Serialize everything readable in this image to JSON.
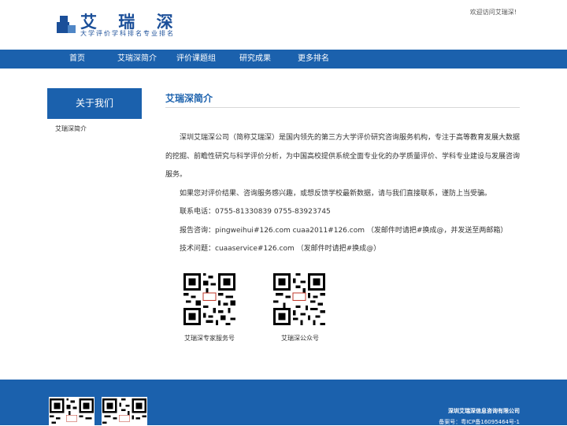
{
  "header": {
    "logo_title": "艾 瑞 深",
    "logo_subtitle": "大学评价学科排名专业排名",
    "welcome_text": "欢迎访问艾瑞深!"
  },
  "nav": {
    "items": [
      "首页",
      "艾瑞深简介",
      "评价课题组",
      "研究成果",
      "更多排名"
    ]
  },
  "sidebar": {
    "title": "关于我们",
    "items": [
      "艾瑞深简介"
    ]
  },
  "main": {
    "title": "艾瑞深简介",
    "paragraph_1": "深圳艾瑞深公司（简称艾瑞深）是国内领先的第三方大学评价研究咨询服务机构，专注于高等教育发展大数据的挖掘、前瞻性研究与科学评价分析，为中国高校提供系统全面专业化的办学质量评价、学科专业建设与发展咨询服务。",
    "paragraph_2": "如果您对评价结果、咨询服务感兴趣，或想反馈学校最新数据，请与我们直接联系，谨防上当受骗。",
    "phone": "联系电话：0755-81330839 0755-83923745",
    "report": "报告咨询：pingweihui#126.com cuaa2011#126.com （发邮件时请把#换成@，并发送至两邮箱）",
    "tech": "技术问题：cuaaservice#126.com （发邮件时请把#换成@）"
  },
  "qr_codes": [
    {
      "label": "艾瑞深专家服务号",
      "icon": "qr-code-icon"
    },
    {
      "label": "艾瑞深公众号",
      "icon": "qr-code-icon"
    }
  ],
  "footer": {
    "company": "深圳艾瑞深信息咨询有限公司",
    "icp": "备案号：粤ICP备16095464号-1"
  },
  "colors": {
    "brand_blue": "#1b61ad",
    "logo_blue": "#1b4f99"
  }
}
